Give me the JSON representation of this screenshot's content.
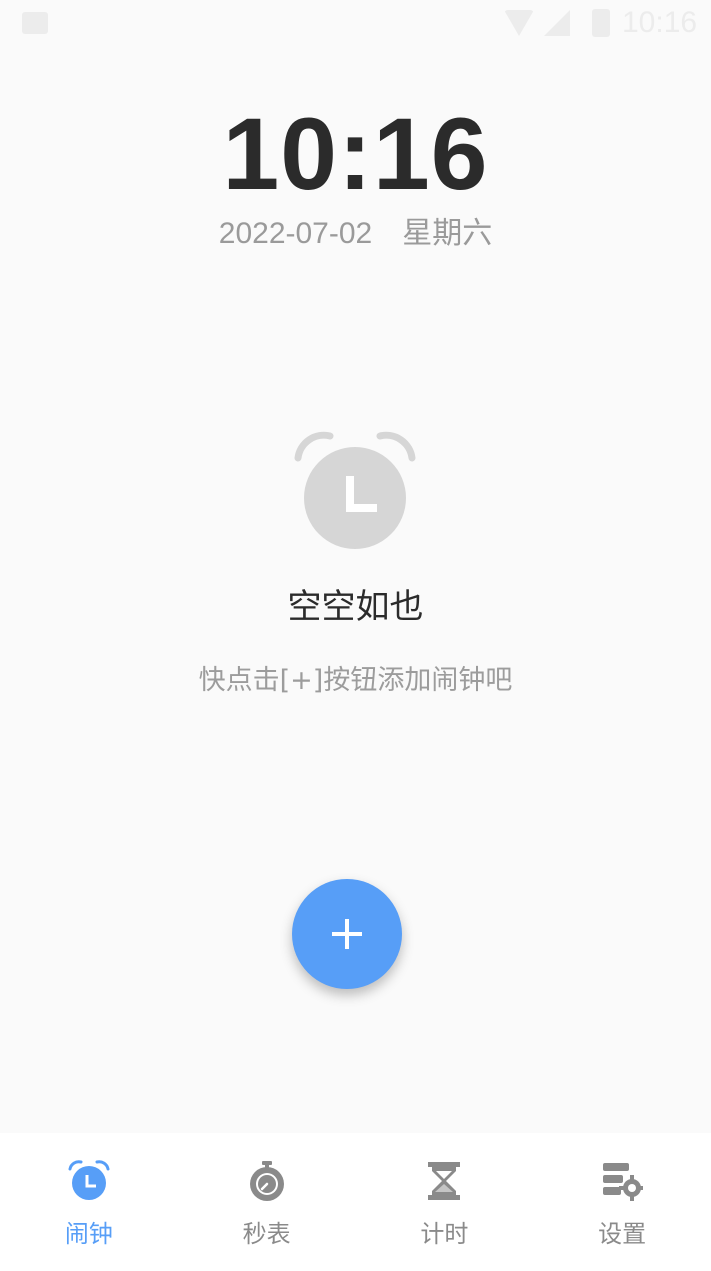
{
  "status_bar": {
    "time": "10:16"
  },
  "clock": {
    "time": "10:16",
    "date": "2022-07-02",
    "weekday": "星期六"
  },
  "empty_state": {
    "icon": "alarm-clock-icon",
    "title": "空空如也",
    "hint": "快点击[+]按钮添加闹钟吧"
  },
  "fab": {
    "icon": "plus-icon"
  },
  "bottom_nav": {
    "items": [
      {
        "label": "闹钟",
        "icon": "alarm-clock-icon",
        "active": true
      },
      {
        "label": "秒表",
        "icon": "stopwatch-icon",
        "active": false
      },
      {
        "label": "计时",
        "icon": "hourglass-icon",
        "active": false
      },
      {
        "label": "设置",
        "icon": "settings-icon",
        "active": false
      }
    ]
  },
  "colors": {
    "accent": "#579ef7",
    "text_primary": "#2b2b2b",
    "text_secondary": "#9a9a9a",
    "icon_inactive": "#8a8a8a",
    "empty_icon": "#d6d6d6"
  }
}
